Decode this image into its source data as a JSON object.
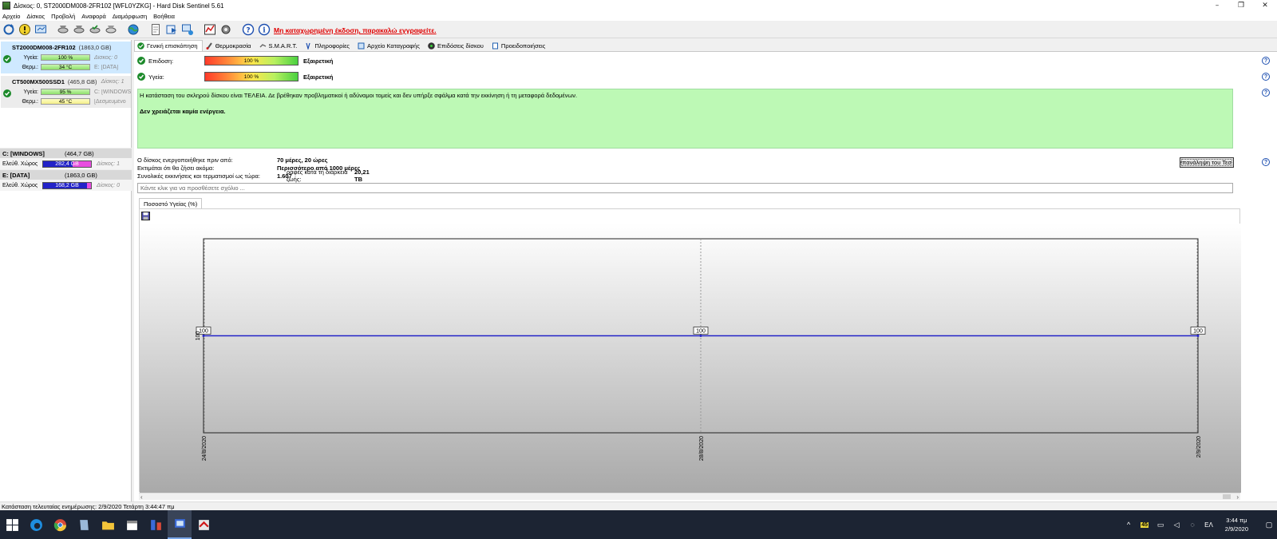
{
  "window": {
    "title": "Δίσκος: 0, ST2000DM008-2FR102 [WFL0YZKG]  -  Hard Disk Sentinel 5.61",
    "controls": {
      "minimize": "–",
      "restore": "❐",
      "close": "✕"
    }
  },
  "menu": [
    "Αρχείο",
    "Δίσκος",
    "Προβολή",
    "Αναφορά",
    "Διαμόρφωση",
    "Βοήθεια"
  ],
  "toolbar": {
    "nag_text": "Μη καταχωρημένη έκδοση, παρακαλώ εγγραφείτε."
  },
  "disks": [
    {
      "name": "ST2000DM008-2FR102",
      "size": "(1863,0 GB)",
      "selected": true,
      "health_label": "Υγεία:",
      "health_value": "100 %",
      "health_pct": 100,
      "health_extra": "Δίσκος: 0",
      "temp_label": "Θερμ.:",
      "temp_value": "34 °C",
      "temp_extra": "E: [DATA]"
    },
    {
      "name": "CT500MX500SSD1",
      "size": "(465,8 GB)",
      "selected": false,
      "health_label": "Υγεία:",
      "health_value": "95 %",
      "health_pct": 95,
      "health_extra": "Δίσκος: 1",
      "health_extra2": "C: [WINDOWS",
      "temp_label": "Θερμ.:",
      "temp_value": "45 °C",
      "temp_extra": "[Δεσμευμένο"
    }
  ],
  "partitions": [
    {
      "name": "C: [WINDOWS]",
      "size": "(464,7 GB)",
      "free_label": "Ελεύθ. Χώρος",
      "free_value": "282,4 GB",
      "free_fraction": 0.61,
      "disk": "Δίσκος: 1"
    },
    {
      "name": "E: [DATA]",
      "size": "(1863,0 GB)",
      "free_label": "Ελεύθ. Χώρος",
      "free_value": "168,2 GB",
      "free_fraction": 0.91,
      "disk": "Δίσκος: 0"
    }
  ],
  "tabs": [
    {
      "label": "Γενική επισκόπηση",
      "icon": "check-icon",
      "active": true
    },
    {
      "label": "Θερμοκρασία",
      "icon": "thermometer-icon",
      "active": false
    },
    {
      "label": "S.M.A.R.T.",
      "icon": "smart-icon",
      "active": false
    },
    {
      "label": "Πληροφορίες",
      "icon": "info-icon",
      "active": false
    },
    {
      "label": "Αρχείο Καταγραφής",
      "icon": "log-icon",
      "active": false
    },
    {
      "label": "Επιδόσεις δίσκου",
      "icon": "performance-icon",
      "active": false
    },
    {
      "label": "Προειδοποιήσεις",
      "icon": "alerts-icon",
      "active": false
    }
  ],
  "overview": {
    "performance_label": "Επιδοση:",
    "performance_value": "100 %",
    "performance_word": "Εξαιρετική",
    "health_label": "Υγεία:",
    "health_value": "100 %",
    "health_word": "Εξαιρετική",
    "message_1": "Η κατάσταση του σκληρού δίσκου είναι ΤΕΛΕΙΑ. Δε βρέθηκαν προβληματικοί ή αδύναμοι τομείς και δεν υπήρξε σφάλμα κατά την εκκίνηση ή τη μεταφορά δεδομένων.",
    "message_2": "Δεν χρειάζεται καμία ενέργεια.",
    "powered_on_label": "Ο δίσκος ενεργοποιήθηκε πριν από:",
    "powered_on_value": "70 μέρες, 20 ώρες",
    "remaining_label": "Εκτιμάται ότι θα ζήσει ακόμα:",
    "remaining_value": "Περισσότερο από 1000 μέρες",
    "starts_label": "Συνολικές εκκινήσεις και τερματισμοί ως τώρα:",
    "starts_value": "1.607",
    "starts_overlap": "ραφές κατά τη διάρκεια ζωής:",
    "starts_overlap_value": "20,21 TB",
    "retest_button": "επανάληψη του Τεσ",
    "comment_placeholder": "Κάντε κλικ για να προσθέσετε σχόλιο ..."
  },
  "chart_tab": "Ποσοστό Υγείας (%)",
  "chart_data": {
    "type": "line",
    "x": [
      "24/8/2020",
      "28/8/2020",
      "2/9/2020"
    ],
    "series": [
      {
        "values": [
          100,
          100,
          100
        ],
        "color": "#2323c8"
      }
    ],
    "ylabel_tick": "100",
    "ylim": [
      0,
      200
    ],
    "grid": true
  },
  "statusbar": "Κατάσταση τελευταίας ενημέρωσης: 2/9/2020 Τετάρτη 3:44:47 πμ",
  "taskbar": {
    "tray_badge": "45",
    "lang": "ΕΛ",
    "time": "3:44 πμ",
    "date": "2/9/2020"
  }
}
